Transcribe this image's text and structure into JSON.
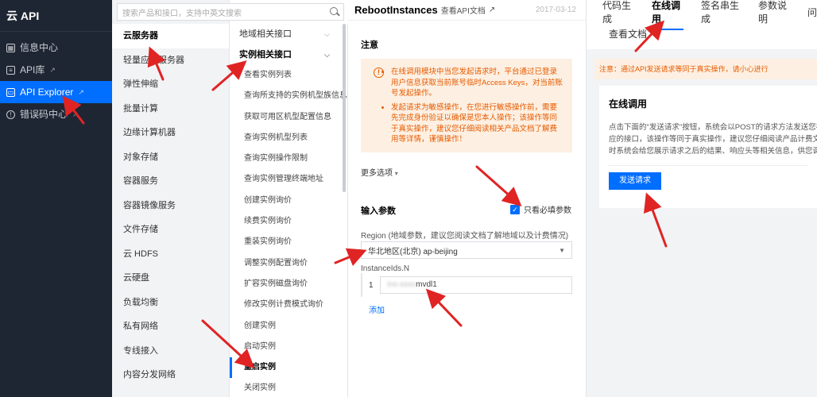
{
  "nav": {
    "brand": "云 API",
    "items": [
      {
        "label": "信息中心",
        "icon": "grid-icon"
      },
      {
        "label": "API库",
        "icon": "list-icon",
        "external": true
      },
      {
        "label": "API Explorer",
        "icon": "monitor-icon",
        "external": true,
        "active": true
      },
      {
        "label": "错误码中心",
        "icon": "info-circle-icon",
        "external": true
      }
    ]
  },
  "search": {
    "placeholder": "搜索产品和接口，支持中英文搜索"
  },
  "products": [
    "云服务器",
    "轻量应用服务器",
    "弹性伸缩",
    "批量计算",
    "边缘计算机器",
    "对象存储",
    "容器服务",
    "容器镜像服务",
    "文件存储",
    "云 HDFS",
    "云硬盘",
    "负载均衡",
    "私有网络",
    "专线接入",
    "内容分发网络"
  ],
  "interfaces": {
    "groups": [
      "地域相关接口",
      "实例相关接口"
    ],
    "items": [
      "查看实例列表",
      "查询所支持的实例机型族信息",
      "获取可用区机型配置信息",
      "查询实例机型列表",
      "查询实例操作限制",
      "查询实例管理终端地址",
      "创建实例询价",
      "续费实例询价",
      "重装实例询价",
      "调整实例配置询价",
      "扩容实例磁盘询价",
      "修改实例计费模式询价",
      "创建实例",
      "启动实例",
      "重启实例",
      "关闭实例"
    ],
    "active": "重启实例"
  },
  "doc": {
    "title": "RebootInstances",
    "api_link": "查看API文档",
    "date": "2017-03-12",
    "notice_title": "注意",
    "notice_items": [
      "在线调用模块中当您发起请求时，平台通过已登录用户信息获取当前账号临时Access Keys，对当前账号发起操作。",
      "发起请求为敏感操作，在您进行敏感操作前，需要先完成身份验证以确保是您本人操作；该操作等同于真实操作，建议您仔细阅读相关产品文档了解费用等详情，谨慎操作！"
    ],
    "more_options": "更多选项",
    "input_params_title": "输入参数",
    "only_required_label": "只看必填参数",
    "region_label": "Region (地域参数，建议您阅读文档了解地域以及计费情况)",
    "region_value": "华北地区(北京) ap-beijing",
    "instance_label": "InstanceIds.N",
    "instance_index": "1",
    "instance_value": "mvdl1",
    "add_label": "添加"
  },
  "right": {
    "tabs": [
      "代码生成",
      "在线调用",
      "签名串生成",
      "参数说明"
    ],
    "tab_overflow": "问",
    "tab_row2": "查看文档",
    "active_tab": "在线调用",
    "warning": "注意：通过API发送请求等同于真实操作，请小心进行",
    "card_title": "在线调用",
    "card_lines": [
      "点击下面的\"发送请求\"按钮，系统会以POST的请求方法发送您在左",
      "应的接口，该操作等同于真实操作，建议您仔细阅读产品计费文档了",
      "时系统会给您展示请求之后的结果、响应头等相关信息，供您调试、"
    ],
    "send_label": "发送请求"
  },
  "colors": {
    "primary": "#006eff",
    "nav_bg": "#1f2633",
    "warning_bg": "#fdf0e2",
    "warning_text": "#e65a00",
    "arrow": "#e02424"
  }
}
